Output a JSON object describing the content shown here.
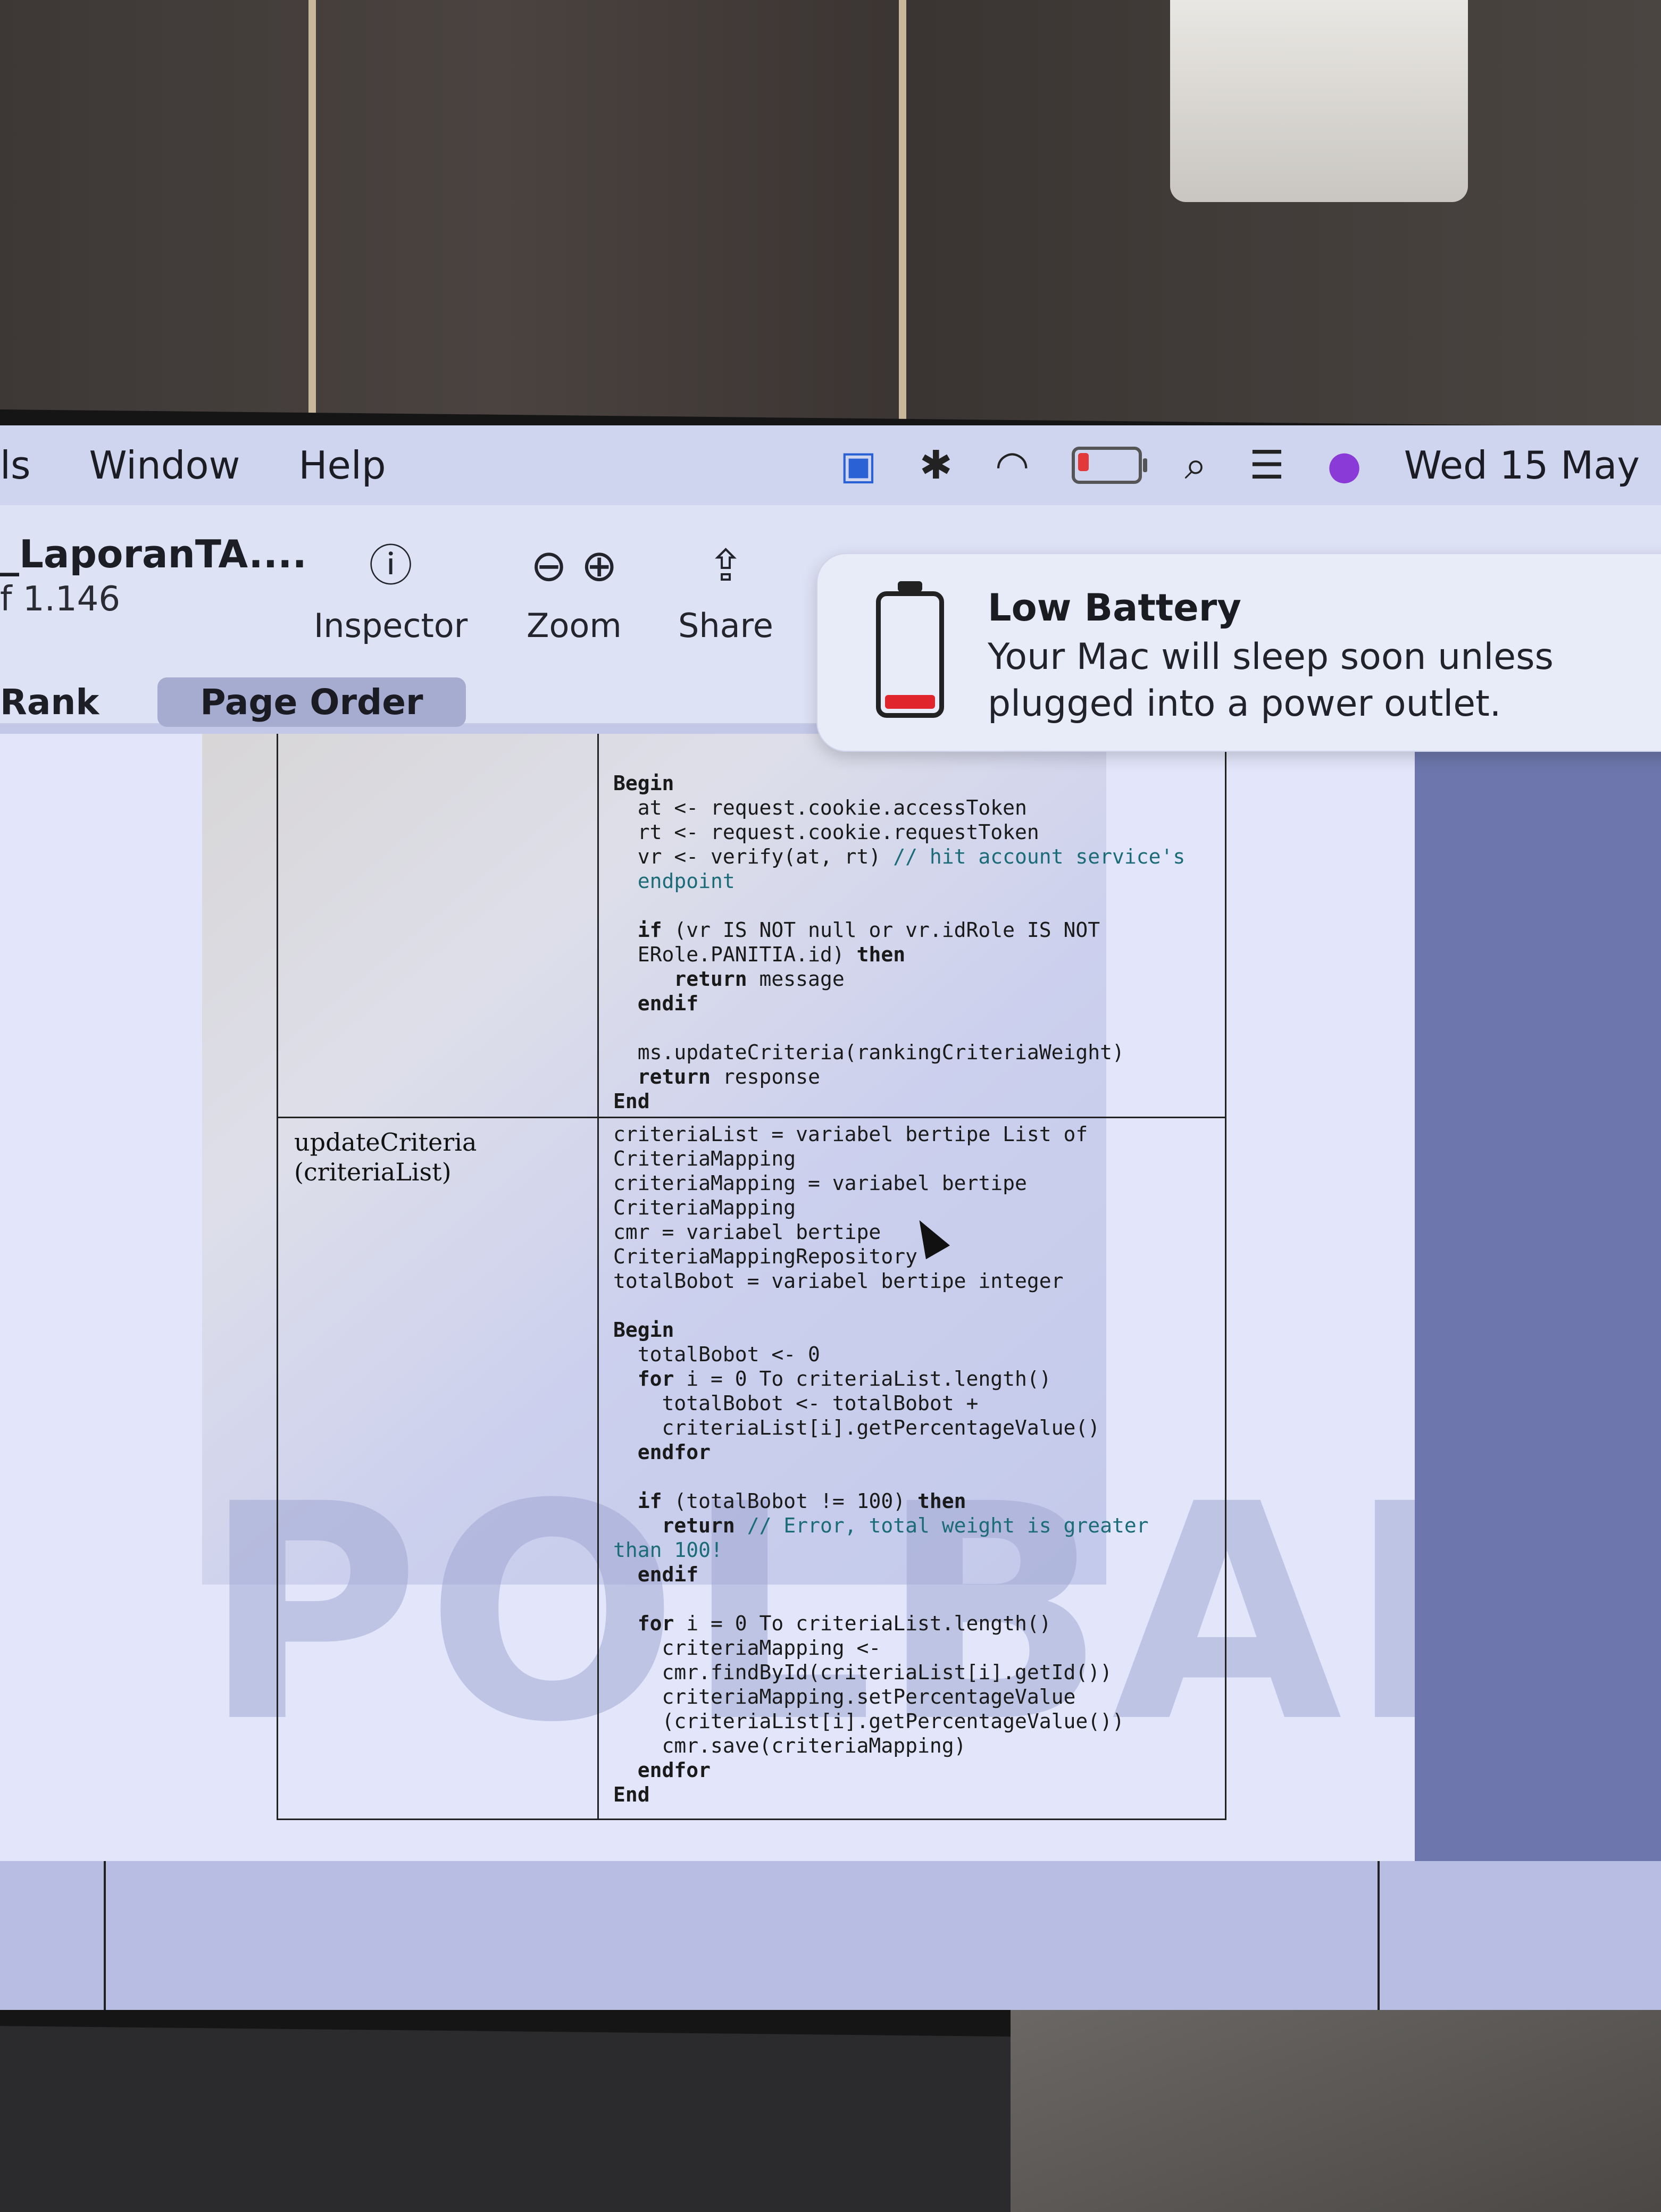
{
  "menubar": {
    "items": [
      "ls",
      "Window",
      "Help"
    ],
    "date": "Wed 15 May"
  },
  "toolbar": {
    "doc_title": "_LaporanTA....",
    "doc_subtitle": "f 1.146",
    "inspector_label": "Inspector",
    "zoom_label": "Zoom",
    "share_label": "Share",
    "seg_rank": "Rank",
    "seg_page_order": "Page Order"
  },
  "notification": {
    "title": "Low Battery",
    "body": "Your Mac will sleep soon unless plugged into a power outlet."
  },
  "document": {
    "watermark": "POLBAN",
    "function_name": "updateCriteria\n(criteriaList)",
    "code_top": [
      {
        "t": "Begin",
        "k": true
      },
      {
        "t": "  at <- request.cookie.accessToken"
      },
      {
        "t": "  rt <- request.cookie.requestToken"
      },
      {
        "t": "  vr <- verify(at, rt) ",
        "c": "// hit account service's"
      },
      {
        "t": "",
        "c": "  endpoint"
      },
      {
        "t": ""
      },
      {
        "t": "  if (vr IS NOT null or vr.idRole IS NOT",
        "k": false,
        "kw": "if"
      },
      {
        "t": "  ERole.PANITIA.id) then"
      },
      {
        "t": "     return message"
      },
      {
        "t": "  endif"
      },
      {
        "t": ""
      },
      {
        "t": "  ms.updateCriteria(rankingCriteriaWeight)"
      },
      {
        "t": "  return response"
      },
      {
        "t": "End"
      }
    ],
    "code_bottom": [
      {
        "t": "criteriaList = variabel bertipe List of"
      },
      {
        "t": "CriteriaMapping"
      },
      {
        "t": "criteriaMapping = variabel bertipe"
      },
      {
        "t": "CriteriaMapping"
      },
      {
        "t": "cmr = variabel bertipe"
      },
      {
        "t": "CriteriaMappingRepository"
      },
      {
        "t": "totalBobot = variabel bertipe integer"
      },
      {
        "t": ""
      },
      {
        "t": "Begin"
      },
      {
        "t": "  totalBobot <- 0"
      },
      {
        "t": "  for i = 0 To criteriaList.length()"
      },
      {
        "t": "    totalBobot <- totalBobot +"
      },
      {
        "t": "    criteriaList[i].getPercentageValue()"
      },
      {
        "t": "  endfor"
      },
      {
        "t": ""
      },
      {
        "t": "  if (totalBobot != 100) then"
      },
      {
        "t": "    return ",
        "c": "// Error, total weight is greater"
      },
      {
        "t": "",
        "c": "than 100!"
      },
      {
        "t": "  endif"
      },
      {
        "t": ""
      },
      {
        "t": "  for i = 0 To criteriaList.length()"
      },
      {
        "t": "    criteriaMapping <-"
      },
      {
        "t": "    cmr.findById(criteriaList[i].getId())"
      },
      {
        "t": "    criteriaMapping.setPercentageValue"
      },
      {
        "t": "    (criteriaList[i].getPercentageValue())"
      },
      {
        "t": "    cmr.save(criteriaMapping)"
      },
      {
        "t": "  endfor"
      },
      {
        "t": "End"
      }
    ]
  },
  "icons": {
    "inspector": "info-icon",
    "zoom_out": "zoom-out-icon",
    "zoom_in": "zoom-in-icon",
    "share": "share-icon"
  },
  "colors": {
    "comment": "#1c6b78",
    "battery_low": "#e0262c"
  }
}
